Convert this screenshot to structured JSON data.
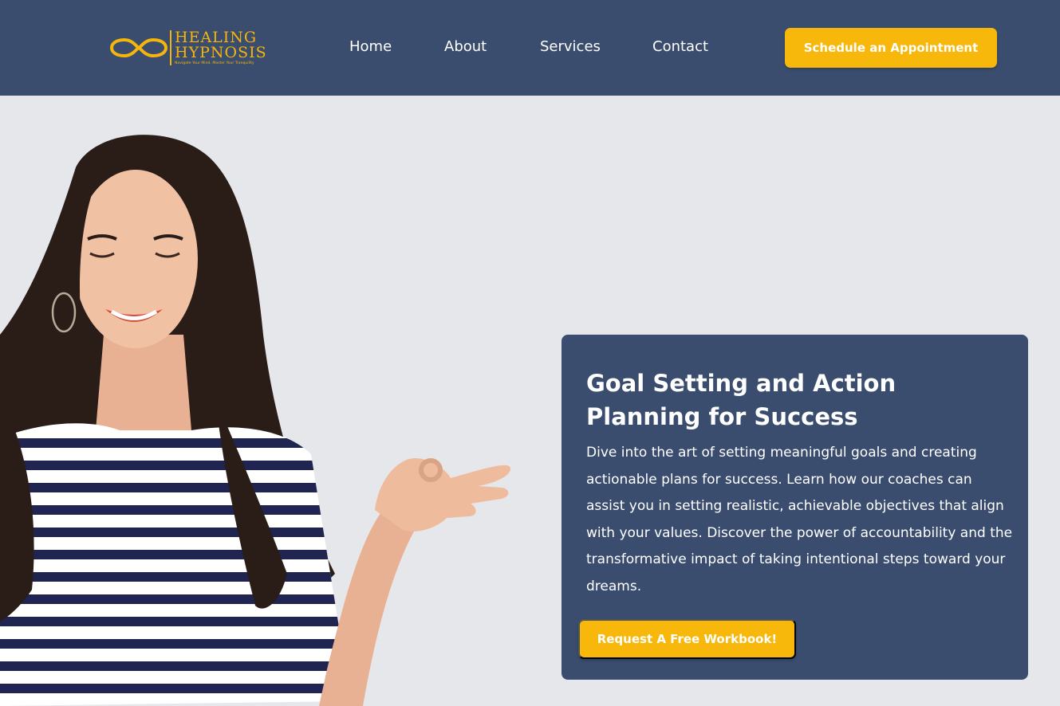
{
  "brand": {
    "word1": "HEALING",
    "word2": "HYPNOSIS",
    "tagline": "Navigate Your Mind, Master Your Tranquility",
    "logo_icon": "infinity-icon",
    "color": "#f5b50a"
  },
  "nav": {
    "items": [
      {
        "label": "Home"
      },
      {
        "label": "About"
      },
      {
        "label": "Services"
      },
      {
        "label": "Contact"
      }
    ],
    "cta_label": "Schedule an Appointment"
  },
  "hero": {
    "image": "woman-meditating-photo",
    "card": {
      "title": "Goal Setting and Action Planning for Success",
      "body": "Dive into the art of setting meaningful goals and creating actionable plans for success. Learn how our coaches can assist you in setting realistic, achievable objectives that align with your values. Discover the power of accountability and the transformative impact of taking intentional steps toward your dreams.",
      "cta_label": "Request A Free Workbook!"
    }
  },
  "colors": {
    "header_bg": "#3a4d6e",
    "accent": "#f7b70b",
    "hero_bg": "#e6e7eb"
  }
}
